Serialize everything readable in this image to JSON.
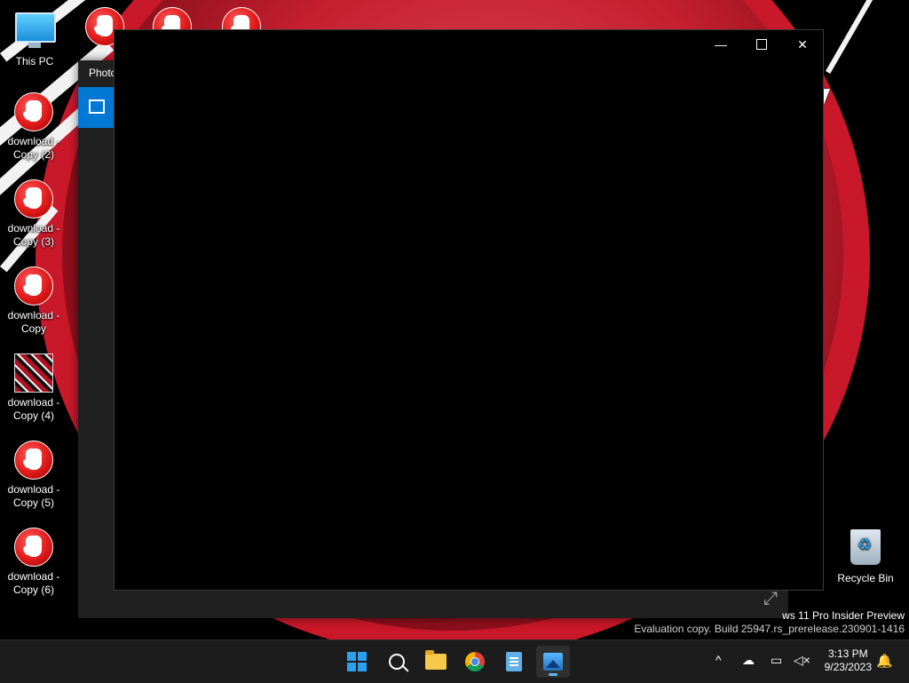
{
  "desktop": {
    "icons": [
      {
        "label": "This PC",
        "icon": "this-pc-icon"
      },
      {
        "label": "download - Copy (2)",
        "icon": "stop-hand-icon"
      },
      {
        "label": "download - Copy (3)",
        "icon": "stop-hand-icon"
      },
      {
        "label": "download - Copy",
        "icon": "stop-hand-icon"
      },
      {
        "label": "download - Copy (4)",
        "icon": "image-thumbnail-icon"
      },
      {
        "label": "download - Copy (5)",
        "icon": "stop-hand-icon"
      },
      {
        "label": "download - Copy (6)",
        "icon": "stop-hand-icon"
      },
      {
        "label": "Recycle Bin",
        "icon": "recycle-bin-icon"
      }
    ]
  },
  "photos_window": {
    "title": "Photo",
    "icon": "photos-app-icon"
  },
  "viewer_window": {
    "minimize_label": "—",
    "maximize_icon": "maximize-icon",
    "close_label": "✕"
  },
  "watermark": {
    "line1": "ws 11 Pro Insider Preview",
    "line2": "Evaluation copy. Build 25947.rs_prerelease.230901-1416"
  },
  "taskbar": {
    "apps": [
      "start-icon",
      "search-icon",
      "file-explorer-icon",
      "chrome-icon",
      "notepad-icon",
      "photos-icon"
    ],
    "active_app": "photos-icon",
    "tray": {
      "chevron": "^",
      "time": "3:13 PM",
      "date": "9/23/2023"
    }
  },
  "colors": {
    "accent": "#0078d4",
    "taskbar": "#1c1c1c",
    "wallpaper_red": "#c41f2f"
  }
}
